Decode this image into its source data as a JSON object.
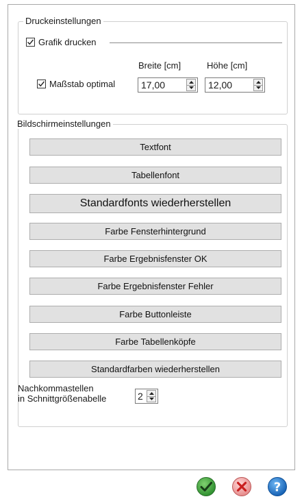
{
  "print_settings": {
    "group_title": "Druckeinstellungen",
    "print_graphic_label": "Grafik drucken",
    "print_graphic_checked": true,
    "scale_optimal_label": "Maßstab optimal",
    "scale_optimal_checked": true,
    "width_label": "Breite [cm]",
    "height_label": "Höhe [cm]",
    "width_value": "17,00",
    "height_value": "12,00"
  },
  "screen_settings": {
    "group_title": "Bildschirmeinstellungen",
    "buttons": [
      "Textfont",
      "Tabellenfont",
      "Standardfonts wiederherstellen",
      "Farbe Fensterhintergrund",
      "Farbe Ergebnisfenster OK",
      "Farbe Ergebnisfenster Fehler",
      "Farbe Buttonleiste",
      "Farbe Tabellenköpfe",
      "Standardfarben wiederherstellen"
    ],
    "decimals_label_line1": "Nachkommastellen",
    "decimals_label_line2": "in Schnittgrößenabelle",
    "decimals_value": "2"
  },
  "footer": {
    "ok_icon": "check-circle-icon",
    "cancel_icon": "x-circle-icon",
    "help_icon": "question-circle-icon",
    "ok_color": "#3aa640",
    "cancel_color": "#d9534f",
    "help_color": "#1e78c8"
  }
}
